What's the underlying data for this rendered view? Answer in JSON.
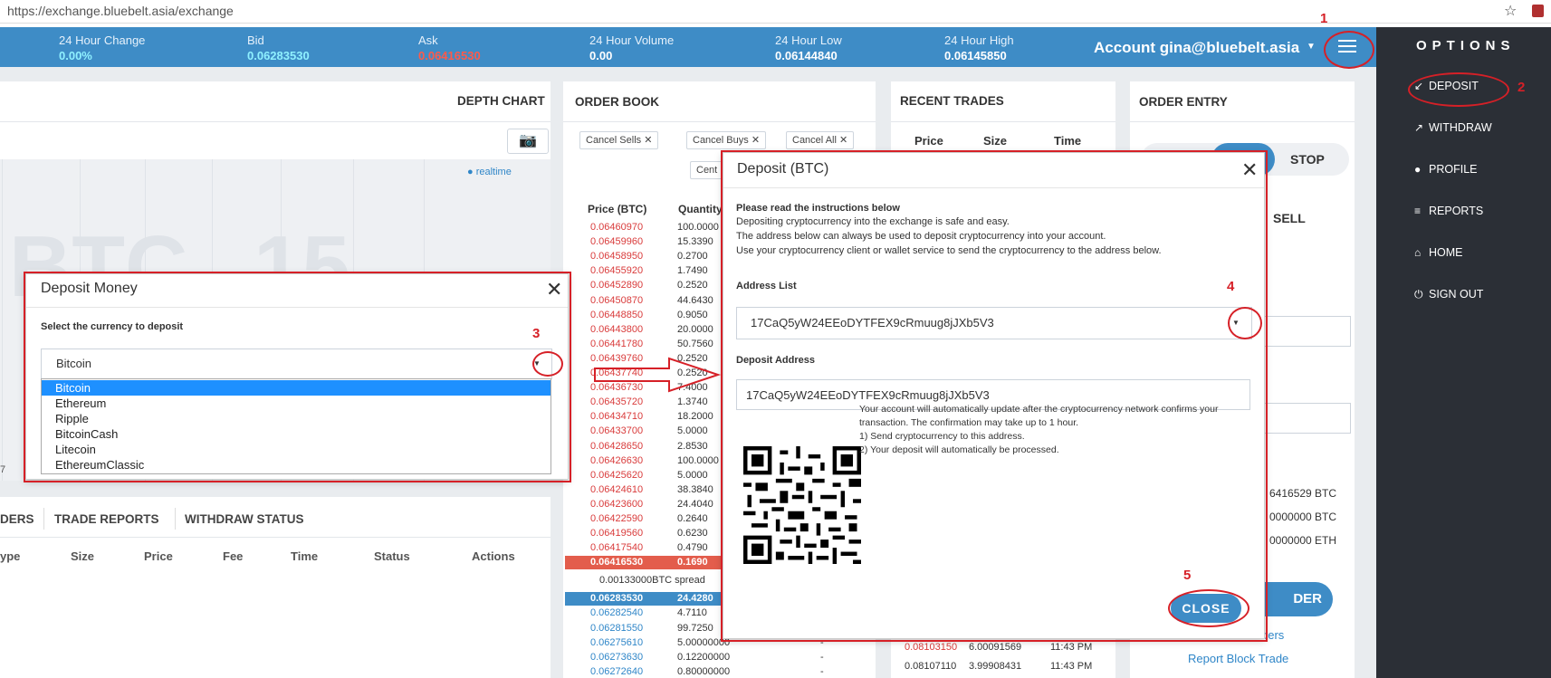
{
  "browser": {
    "url": "https://exchange.bluebelt.asia/exchange"
  },
  "ticker": {
    "change_label": "24 Hour Change",
    "change_value": "0.00%",
    "bid_label": "Bid",
    "bid_value": "0.06283530",
    "ask_label": "Ask",
    "ask_value": "0.06416530",
    "volume_label": "24 Hour Volume",
    "volume_value": "0.00",
    "low_label": "24 Hour Low",
    "low_value": "0.06144840",
    "high_label": "24 Hour High",
    "high_value": "0.06145850",
    "account": "Account gina@bluebelt.asia"
  },
  "sidebar": {
    "title": "OPTIONS",
    "items": [
      {
        "label": "DEPOSIT",
        "icon": "arrow-down-left-icon"
      },
      {
        "label": "WITHDRAW",
        "icon": "arrow-up-right-icon"
      },
      {
        "label": "PROFILE",
        "icon": "user-icon"
      },
      {
        "label": "REPORTS",
        "icon": "list-icon"
      },
      {
        "label": "HOME",
        "icon": "home-icon"
      },
      {
        "label": "SIGN OUT",
        "icon": "power-icon"
      }
    ]
  },
  "depth": {
    "title": "DEPTH CHART",
    "realtime": "realtime",
    "bg_text_1": "BTC",
    "bg_text_2": "15",
    "axis_left": "7"
  },
  "bottom_tabs": {
    "t1": "DERS",
    "t2": "TRADE REPORTS",
    "t3": "WITHDRAW STATUS"
  },
  "bottom_cols": [
    "ype",
    "Size",
    "Price",
    "Fee",
    "Time",
    "Status",
    "Actions"
  ],
  "orderbook": {
    "title": "ORDER BOOK",
    "cancel_sells": "Cancel Sells",
    "cancel_buys": "Cancel Buys",
    "cancel_all": "Cancel All",
    "center_btn": "Cent",
    "col_price": "Price (BTC)",
    "col_qty": "Quantity",
    "asks": [
      [
        "0.06460970",
        "100.0000"
      ],
      [
        "0.06459960",
        "15.3390"
      ],
      [
        "0.06458950",
        "0.2700"
      ],
      [
        "0.06455920",
        "1.7490"
      ],
      [
        "0.06452890",
        "0.2520"
      ],
      [
        "0.06450870",
        "44.6430"
      ],
      [
        "0.06448850",
        "0.9050"
      ],
      [
        "0.06443800",
        "20.0000"
      ],
      [
        "0.06441780",
        "50.7560"
      ],
      [
        "0.06439760",
        "0.2520"
      ],
      [
        "0.06437740",
        "0.2520"
      ],
      [
        "0.06436730",
        "7.4000"
      ],
      [
        "0.06435720",
        "1.3740"
      ],
      [
        "0.06434710",
        "18.2000"
      ],
      [
        "0.06433700",
        "5.0000"
      ],
      [
        "0.06428650",
        "2.8530"
      ],
      [
        "0.06426630",
        "100.0000"
      ],
      [
        "0.06425620",
        "5.0000"
      ],
      [
        "0.06424610",
        "38.3840"
      ],
      [
        "0.06423600",
        "24.4040"
      ],
      [
        "0.06422590",
        "0.2640"
      ],
      [
        "0.06419560",
        "0.6230"
      ],
      [
        "0.06417540",
        "0.4790"
      ]
    ],
    "best_ask": [
      "0.06416530",
      "0.1690"
    ],
    "spread": "0.00133000BTC spread",
    "best_bid": [
      "0.06283530",
      "24.4280"
    ],
    "bids": [
      [
        "0.06282540",
        "4.7110",
        ""
      ],
      [
        "0.06281550",
        "99.7250",
        ""
      ],
      [
        "0.06275610",
        "5.00000000",
        "-"
      ],
      [
        "0.06273630",
        "0.12200000",
        "-"
      ],
      [
        "0.06272640",
        "0.80000000",
        "-"
      ]
    ]
  },
  "recent_trades": {
    "title": "RECENT TRADES",
    "col_price": "Price",
    "col_size": "Size",
    "col_time": "Time",
    "rows": [
      [
        "0.08103150",
        "6.00091569",
        "11:43 PM"
      ],
      [
        "0.08107110",
        "3.99908431",
        "11:43 PM"
      ]
    ]
  },
  "order_entry": {
    "title": "ORDER ENTRY",
    "stop": "STOP",
    "sell": "SELL",
    "bal1": "6416529 BTC",
    "bal2": "0000000 BTC",
    "bal3": "0000000 ETH",
    "order_btn": "DER",
    "link1": "ders",
    "link2": "Report Block Trade"
  },
  "deposit_money": {
    "title": "Deposit Money",
    "label": "Select the currency to deposit",
    "selected": "Bitcoin",
    "options": [
      "Bitcoin",
      "Ethereum",
      "Ripple",
      "BitcoinCash",
      "Litecoin",
      "EthereumClassic"
    ]
  },
  "deposit_btc": {
    "title": "Deposit (BTC)",
    "instr_heading": "Please read the instructions below",
    "instr_1": "Depositing cryptocurrency into the exchange is safe and easy.",
    "instr_2": "The address below can always be used to deposit cryptocurrency into your account.",
    "instr_3": "Use your cryptocurrency client or wallet service to send the cryptocurrency to the address below.",
    "address_list_label": "Address List",
    "address_list_value": "17CaQ5yW24EEoDYTFEX9cRmuug8jJXb5V3",
    "deposit_address_label": "Deposit Address",
    "deposit_address_value": "17CaQ5yW24EEoDYTFEX9cRmuug8jJXb5V3",
    "qr_text_1": "Your account will automatically update after the cryptocurrency network confirms your",
    "qr_text_2": "transaction. The confirmation may take up to 1 hour.",
    "qr_text_3": "1) Send cryptocurrency to this address.",
    "qr_text_4": "2) Your deposit will automatically be processed.",
    "close": "CLOSE"
  },
  "annotations": {
    "n1": "1",
    "n2": "2",
    "n3": "3",
    "n4": "4",
    "n5": "5"
  },
  "colors": {
    "accent": "#3e8cc6",
    "annotation": "#d62027",
    "ask": "#d93b3b",
    "bid": "#2f86c8",
    "sidebar": "#2b2f36"
  }
}
